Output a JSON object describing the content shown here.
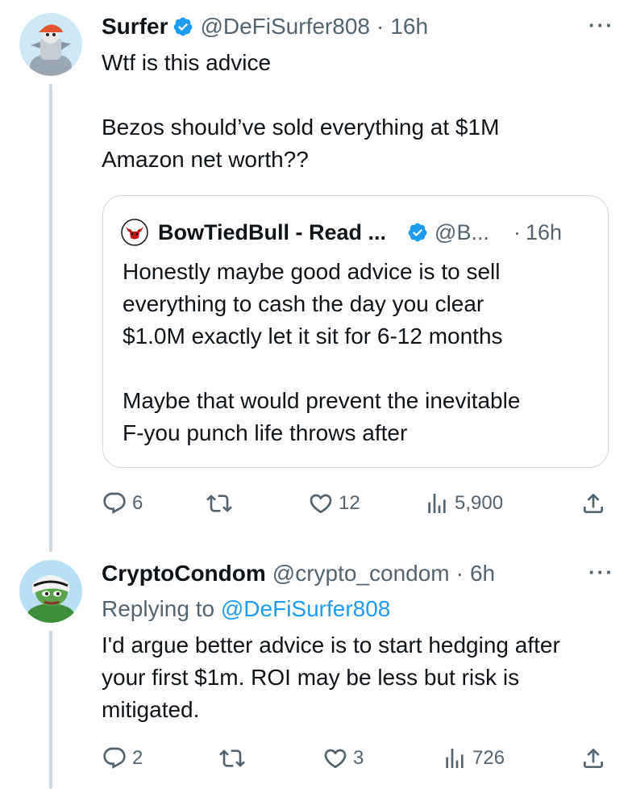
{
  "tweets": [
    {
      "author_name": "Surfer",
      "handle": "@DeFiSurfer808",
      "separator": "·",
      "time": "16h",
      "more": "···",
      "text": "Wtf is this advice\n\nBezos should’ve sold everything at $1M\nAmazon net worth??",
      "quote": {
        "author_name": "BowTiedBull - Read ...",
        "handle": "@B...",
        "separator": "·",
        "time": "16h",
        "text": "Honestly maybe good advice is to sell\neverything to cash the day you clear\n$1.0M exactly let it sit for 6-12 months\n\nMaybe that would prevent the inevitable\nF-you punch life throws after"
      },
      "stats": {
        "replies": "6",
        "retweets": "",
        "likes": "12",
        "views": "5,900"
      }
    },
    {
      "author_name": "CryptoCondom",
      "handle": "@crypto_condom",
      "separator": "·",
      "time": "6h",
      "more": "···",
      "replying_label": "Replying to ",
      "replying_handle": "@DeFiSurfer808",
      "text": "I'd argue better advice is to start hedging after\nyour first $1m. ROI may be less but risk is\nmitigated.",
      "stats": {
        "replies": "2",
        "retweets": "",
        "likes": "3",
        "views": "726"
      }
    }
  ],
  "colors": {
    "accent": "#1d9bf0",
    "muted": "#536471",
    "border": "#cfd9de",
    "text": "#0f1419"
  },
  "icons": [
    "reply-icon",
    "retweet-icon",
    "like-icon",
    "views-icon",
    "share-icon",
    "verified-badge-icon",
    "more-icon"
  ]
}
